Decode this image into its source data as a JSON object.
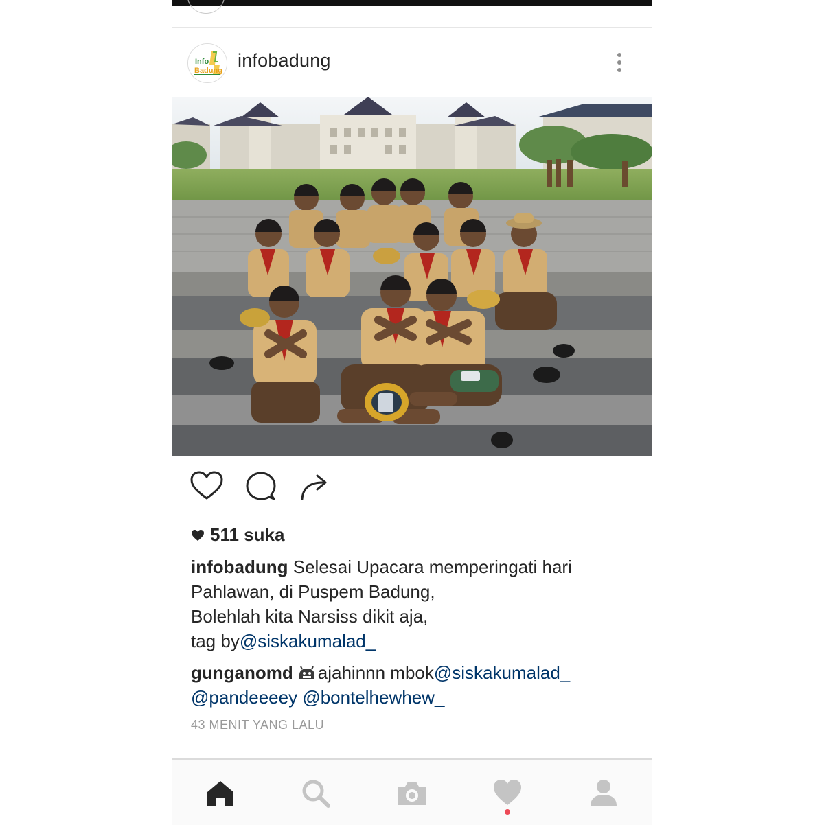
{
  "post": {
    "username": "infobadung",
    "avatar_text": "Info Badung",
    "photo_alt": "",
    "likes": "511 suka",
    "caption": {
      "username": "infobadung",
      "line1": "Selesai Upacara memperingati hari",
      "line2": "Pahlawan, di Puspem Badung,",
      "line3": "Bolehlah kita Narsiss dikit aja,",
      "line4_prefix": "tag by",
      "line4_mention": "@siskakumalad_"
    },
    "comment": {
      "username": "gunganomd",
      "text": "ajahinnn mbok",
      "mention1": "@siskakumalad_",
      "mention2": "@pandeeeey",
      "mention3": "@bontelhewhew_"
    },
    "timestamp": "43 MENIT YANG LALU"
  },
  "icons": {
    "more": "more-vertical-icon",
    "like": "heart-outline-icon",
    "comment": "comment-bubble-icon",
    "share": "share-arrow-icon",
    "likes_heart": "heart-filled-icon",
    "nav": [
      "home-icon",
      "search-icon",
      "camera-icon",
      "heart-icon",
      "profile-icon"
    ]
  },
  "colors": {
    "text": "#262626",
    "mention": "#003569",
    "muted": "#999999",
    "notification": "#ed4956",
    "nav_active": "#262626",
    "nav_inactive": "#c4c4c4"
  }
}
